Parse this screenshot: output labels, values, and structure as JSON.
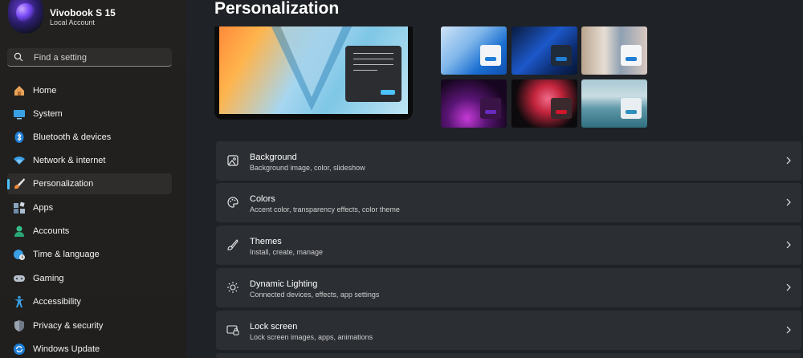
{
  "account": {
    "name": "Vivobook S 15",
    "type": "Local Account"
  },
  "search": {
    "placeholder": "Find a setting",
    "icon": "search-icon"
  },
  "sidebar": {
    "active": "Personalization",
    "accent_color": "#4cc2ff",
    "items": [
      {
        "label": "Home",
        "icon": "home-icon"
      },
      {
        "label": "System",
        "icon": "system-icon"
      },
      {
        "label": "Bluetooth & devices",
        "icon": "bluetooth-icon"
      },
      {
        "label": "Network & internet",
        "icon": "wifi-icon"
      },
      {
        "label": "Personalization",
        "icon": "paintbrush-icon"
      },
      {
        "label": "Apps",
        "icon": "apps-icon"
      },
      {
        "label": "Accounts",
        "icon": "accounts-icon"
      },
      {
        "label": "Time & language",
        "icon": "globe-clock-icon"
      },
      {
        "label": "Gaming",
        "icon": "gamepad-icon"
      },
      {
        "label": "Accessibility",
        "icon": "accessibility-icon"
      },
      {
        "label": "Privacy & security",
        "icon": "shield-icon"
      },
      {
        "label": "Windows Update",
        "icon": "update-icon"
      }
    ]
  },
  "main": {
    "title": "Personalization",
    "themes": [
      {
        "name": "theme-windows-light",
        "accent": "#1f7ed6"
      },
      {
        "name": "theme-windows-dark",
        "accent": "#1f7ed6"
      },
      {
        "name": "theme-flowers",
        "accent": "#1f7ed6"
      },
      {
        "name": "theme-glow",
        "accent": "#6a2bbf"
      },
      {
        "name": "theme-captured-motion",
        "accent": "#d0162a"
      },
      {
        "name": "theme-sunrise-lake",
        "accent": "#2d8fbf"
      }
    ],
    "settings": [
      {
        "title": "Background",
        "subtitle": "Background image, color, slideshow",
        "icon": "picture-icon"
      },
      {
        "title": "Colors",
        "subtitle": "Accent color, transparency effects, color theme",
        "icon": "palette-icon"
      },
      {
        "title": "Themes",
        "subtitle": "Install, create, manage",
        "icon": "brush-icon"
      },
      {
        "title": "Dynamic Lighting",
        "subtitle": "Connected devices, effects, app settings",
        "icon": "sun-icon"
      },
      {
        "title": "Lock screen",
        "subtitle": "Lock screen images, apps, animations",
        "icon": "lock-screen-icon"
      }
    ]
  }
}
